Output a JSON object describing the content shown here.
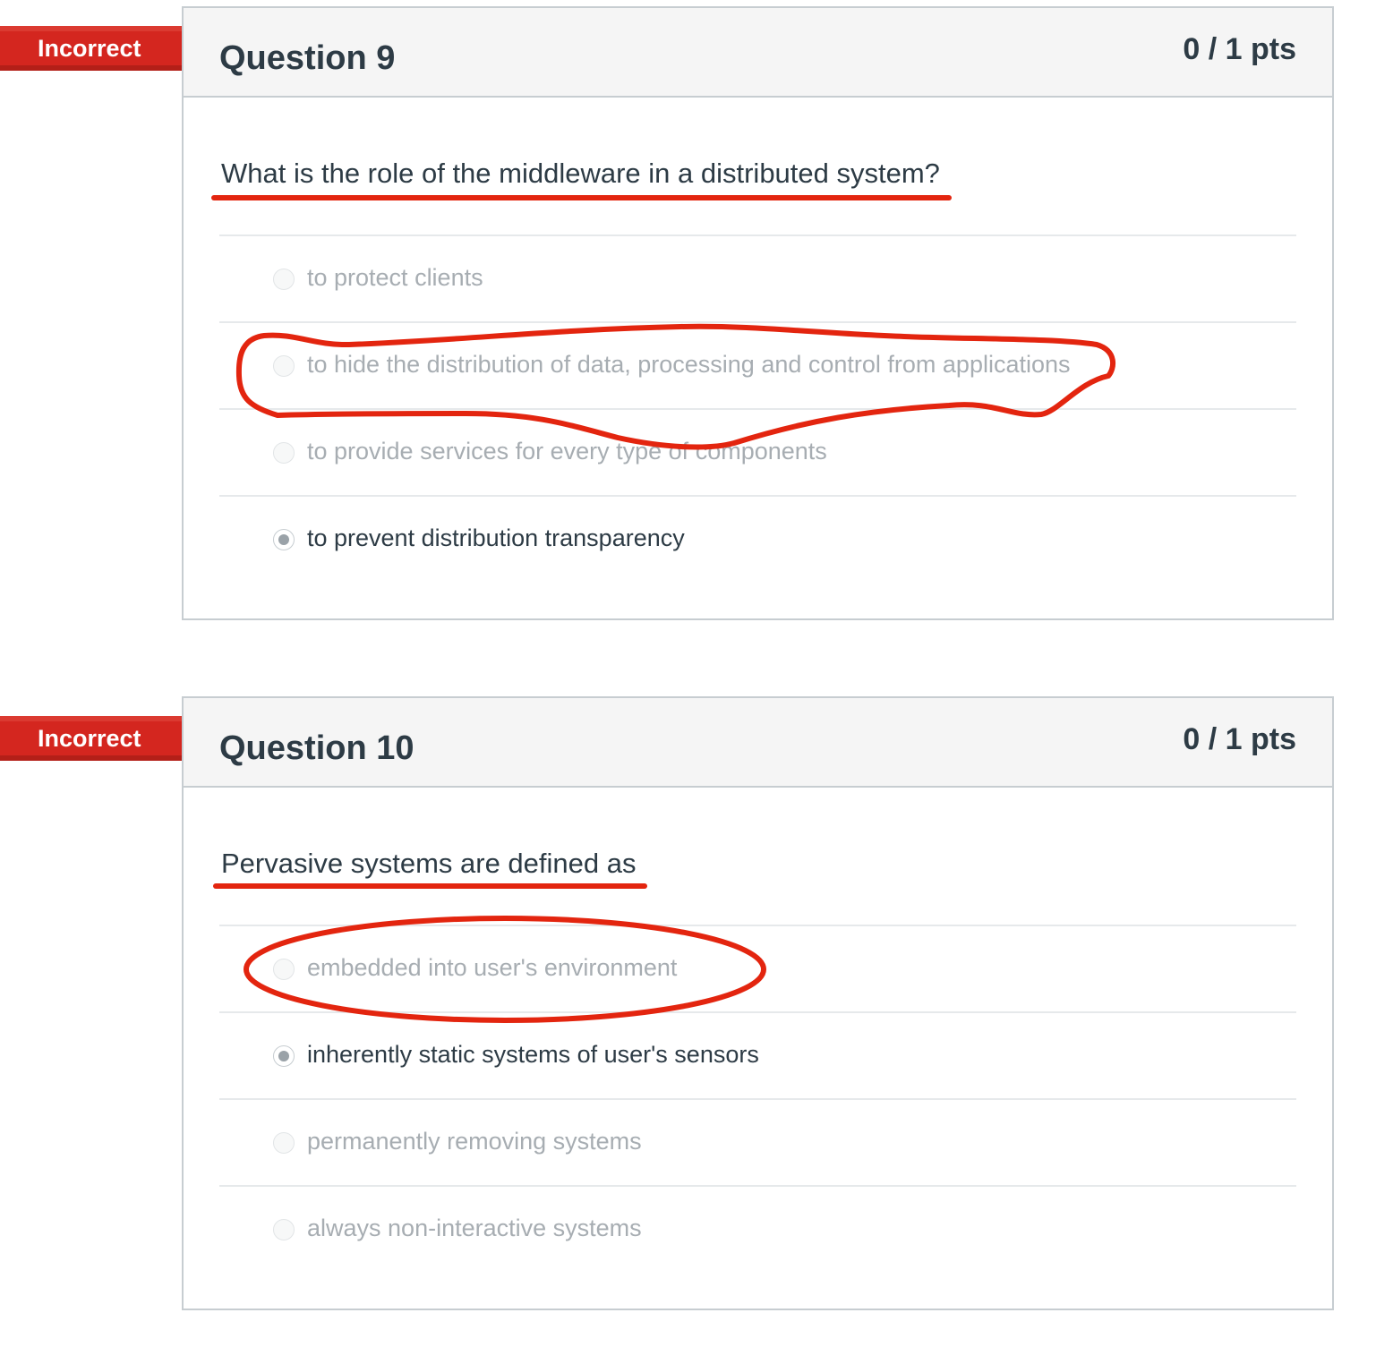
{
  "questions": [
    {
      "status": "Incorrect",
      "title": "Question 9",
      "points": "0 / 1 pts",
      "text": "What is the role of the middleware in a distributed system?",
      "answers": [
        {
          "label": "to protect clients",
          "selected": false
        },
        {
          "label": "to hide the distribution of data, processing and control from applications",
          "selected": false
        },
        {
          "label": "to provide services for every type of components",
          "selected": false
        },
        {
          "label": "to prevent distribution transparency",
          "selected": true
        }
      ]
    },
    {
      "status": "Incorrect",
      "title": "Question 10",
      "points": "0 / 1 pts",
      "text": "Pervasive systems are defined as",
      "answers": [
        {
          "label": "embedded into user's environment",
          "selected": false
        },
        {
          "label": "inherently static systems of user's sensors",
          "selected": true
        },
        {
          "label": "permanently removing systems",
          "selected": false
        },
        {
          "label": "always non-interactive systems",
          "selected": false
        }
      ]
    }
  ],
  "colors": {
    "ribbon": "#d4261f",
    "ribbon_dark": "#9c1a14",
    "annotation": "#e3250f",
    "header_bg": "#f5f5f5",
    "border": "#c7cdd1",
    "text": "#2d3b45",
    "muted_text": "#a7adb2"
  },
  "icons": {
    "ribbon": "flag-ribbon-icon",
    "radio": "radio-button-icon"
  }
}
